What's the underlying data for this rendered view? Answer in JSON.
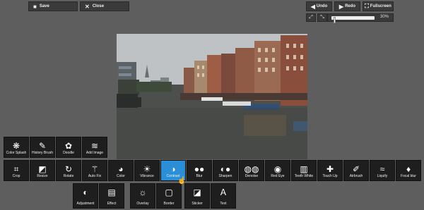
{
  "topbar": {
    "save_label": "Save",
    "close_label": "Close",
    "undo_label": "Undo",
    "redo_label": "Redo",
    "fullscreen_label": "Fullscreen"
  },
  "zoom": {
    "value_label": "30%",
    "level": 0.05
  },
  "canvas": {
    "description": "photo-canal-buildings"
  },
  "tools": {
    "row1": [
      {
        "label": "Color Splash",
        "icon": "color-splash-icon"
      },
      {
        "label": "History Brush",
        "icon": "history-brush-icon"
      },
      {
        "label": "Doodle",
        "icon": "doodle-icon"
      },
      {
        "label": "Add Image",
        "icon": "add-image-icon"
      }
    ],
    "row2": [
      {
        "label": "Crop",
        "icon": "crop-icon"
      },
      {
        "label": "Resize",
        "icon": "resize-icon"
      },
      {
        "label": "Rotate",
        "icon": "rotate-icon"
      },
      {
        "label": "Auto Fix",
        "icon": "auto-fix-icon"
      },
      {
        "label": "Color",
        "icon": "color-palette-icon"
      },
      {
        "label": "Vibrance",
        "icon": "vibrance-icon"
      },
      {
        "label": "Contrast",
        "icon": "contrast-icon"
      },
      {
        "label": "Blur",
        "icon": "blur-icon"
      },
      {
        "label": "Sharpen",
        "icon": "sharpen-icon"
      },
      {
        "label": "Denoise",
        "icon": "denoise-icon"
      },
      {
        "label": "Red Eye",
        "icon": "red-eye-icon"
      },
      {
        "label": "Teeth White",
        "icon": "teeth-white-icon"
      },
      {
        "label": "Touch Up",
        "icon": "touch-up-icon"
      },
      {
        "label": "Airbrush",
        "icon": "airbrush-icon"
      },
      {
        "label": "Liquify",
        "icon": "liquify-icon"
      },
      {
        "label": "Focal blur",
        "icon": "focal-blur-icon"
      }
    ],
    "row3": [
      {
        "label": "Adjustment",
        "icon": "adjustment-icon"
      },
      {
        "label": "Effect",
        "icon": "effect-icon"
      },
      {
        "label": "Overlay",
        "icon": "overlay-icon"
      },
      {
        "label": "Border",
        "icon": "border-icon"
      },
      {
        "label": "Sticker",
        "icon": "sticker-icon"
      },
      {
        "label": "Text",
        "icon": "text-icon"
      }
    ],
    "active": "Contrast"
  },
  "colors": {
    "background": "#5e5e5e",
    "tool_bg": "#1e1e1e",
    "active": "#2a8fd6"
  }
}
